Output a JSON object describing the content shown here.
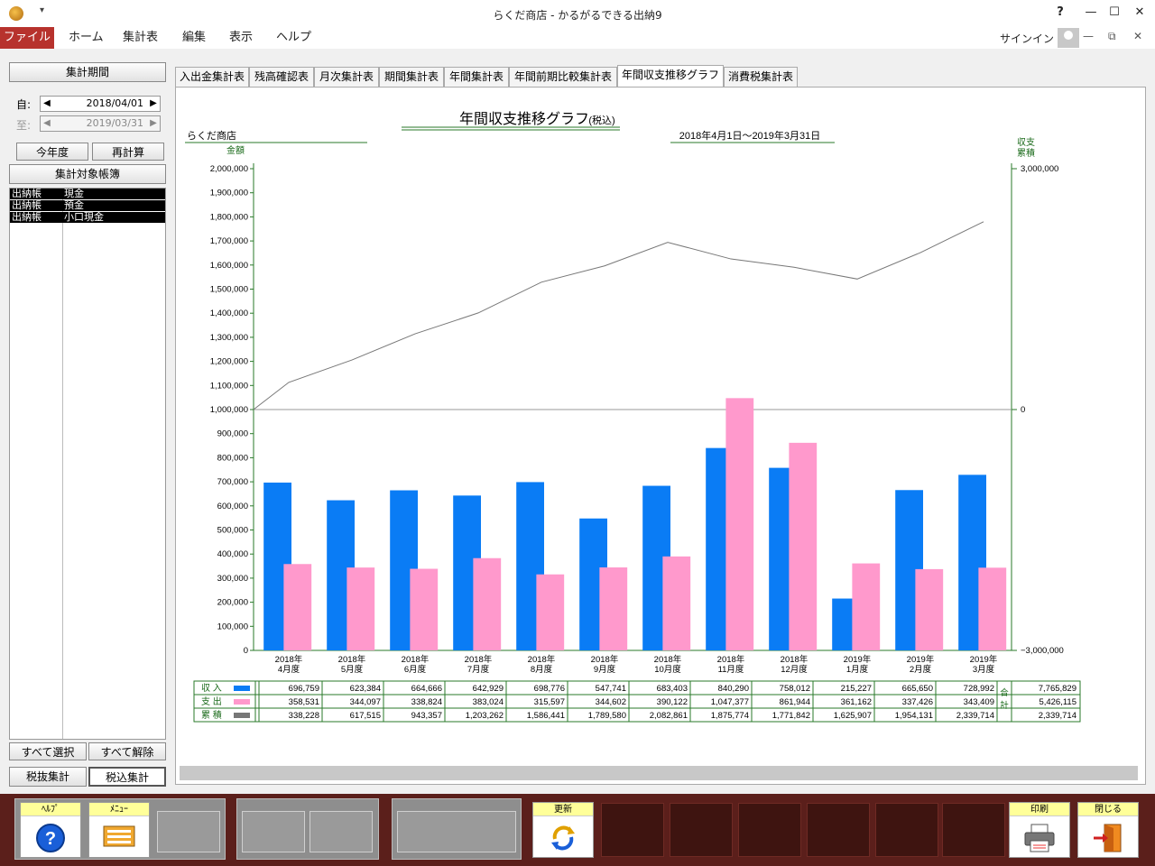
{
  "window": {
    "title": "らくだ商店 - かるがるできる出納9",
    "help_glyph": "?",
    "min_glyph": "—",
    "max_glyph": "☐",
    "close_glyph": "✕",
    "qa_glyph": "▾"
  },
  "ribbon": {
    "tabs": [
      "ファイル",
      "ホーム",
      "集計表",
      "編集",
      "表示",
      "ヘルプ"
    ],
    "signin": "サインイン",
    "min_glyph": "—",
    "restore_glyph": "⧉",
    "close_glyph": "✕"
  },
  "left_panel": {
    "period_button": "集計期間",
    "from_label": "自:",
    "to_label": "至:",
    "from_date": "2018/04/01",
    "to_date": "2019/03/31",
    "left_arrow": "◀",
    "right_arrow": "▶",
    "this_year_button": "今年度",
    "recalc_button": "再計算",
    "target_ledgers_button": "集計対象帳簿",
    "ledgers": [
      {
        "type": "出納帳",
        "name": "現金"
      },
      {
        "type": "出納帳",
        "name": "預金"
      },
      {
        "type": "出納帳",
        "name": "小口現金"
      }
    ],
    "select_all_button": "すべて選択",
    "deselect_all_button": "すべて解除",
    "tax_excl_button": "税抜集計",
    "tax_incl_button": "税込集計"
  },
  "tabs": [
    "入出金集計表",
    "残高確認表",
    "月次集計表",
    "期間集計表",
    "年間集計表",
    "年間前期比較集計表",
    "年間収支推移グラフ",
    "消費税集計表"
  ],
  "active_tab": 6,
  "report": {
    "title": "年間収支推移グラフ",
    "title_suffix": "(税込)",
    "company": "らくだ商店",
    "period": "2018年4月1日～2019年3月31日",
    "left_axis_label": "金額",
    "right_axis_label_1": "収支",
    "right_axis_label_2": "累積"
  },
  "chart_data": {
    "type": "bar",
    "categories": [
      "2018年\n4月度",
      "2018年\n5月度",
      "2018年\n6月度",
      "2018年\n7月度",
      "2018年\n8月度",
      "2018年\n9月度",
      "2018年\n10月度",
      "2018年\n11月度",
      "2018年\n12月度",
      "2019年\n1月度",
      "2019年\n2月度",
      "2019年\n3月度"
    ],
    "left_ticks": [
      "0",
      "100,000",
      "200,000",
      "300,000",
      "400,000",
      "500,000",
      "600,000",
      "700,000",
      "800,000",
      "900,000",
      "1,000,000",
      "1,100,000",
      "1,200,000",
      "1,300,000",
      "1,400,000",
      "1,500,000",
      "1,600,000",
      "1,700,000",
      "1,800,000",
      "1,900,000",
      "2,000,000"
    ],
    "right_ticks": [
      "3,000,000",
      "0",
      "−3,000,000"
    ],
    "ylim_left": [
      0,
      2000000
    ],
    "ylim_right": [
      -3000000,
      3000000
    ],
    "series": [
      {
        "name": "収入",
        "color": "#0a7cf5",
        "values": [
          696759,
          623384,
          664666,
          642929,
          698776,
          547741,
          683403,
          840290,
          758012,
          215227,
          665650,
          728992
        ]
      },
      {
        "name": "支出",
        "color": "#ff99cc",
        "values": [
          358531,
          344097,
          338824,
          383024,
          315597,
          344602,
          390122,
          1047377,
          861944,
          361162,
          337426,
          343409
        ]
      },
      {
        "name": "累積",
        "color": "#777777",
        "values": [
          338228,
          617515,
          943357,
          1203262,
          1586441,
          1789580,
          2082861,
          1875774,
          1771842,
          1625907,
          1954131,
          2339714
        ]
      }
    ],
    "table": {
      "row_labels": [
        "収 入",
        "支 出",
        "累 積"
      ],
      "cells": [
        [
          "696,759",
          "623,384",
          "664,666",
          "642,929",
          "698,776",
          "547,741",
          "683,403",
          "840,290",
          "758,012",
          "215,227",
          "665,650",
          "728,992"
        ],
        [
          "358,531",
          "344,097",
          "338,824",
          "383,024",
          "315,597",
          "344,602",
          "390,122",
          "1,047,377",
          "861,944",
          "361,162",
          "337,426",
          "343,409"
        ],
        [
          "338,228",
          "617,515",
          "943,357",
          "1,203,262",
          "1,586,441",
          "1,789,580",
          "2,082,861",
          "1,875,774",
          "1,771,842",
          "1,625,907",
          "1,954,131",
          "2,339,714"
        ]
      ],
      "total_label_1": "合",
      "total_label_2": "計",
      "totals": [
        "7,765,829",
        "5,426,115",
        "2,339,714"
      ]
    }
  },
  "footer": {
    "help_label": "ﾍﾙﾌﾟ",
    "menu_label": "ﾒﾆｭｰ",
    "refresh_label": "更新",
    "print_label": "印刷",
    "close_label": "閉じる",
    "help_icon_glyph": "?"
  }
}
